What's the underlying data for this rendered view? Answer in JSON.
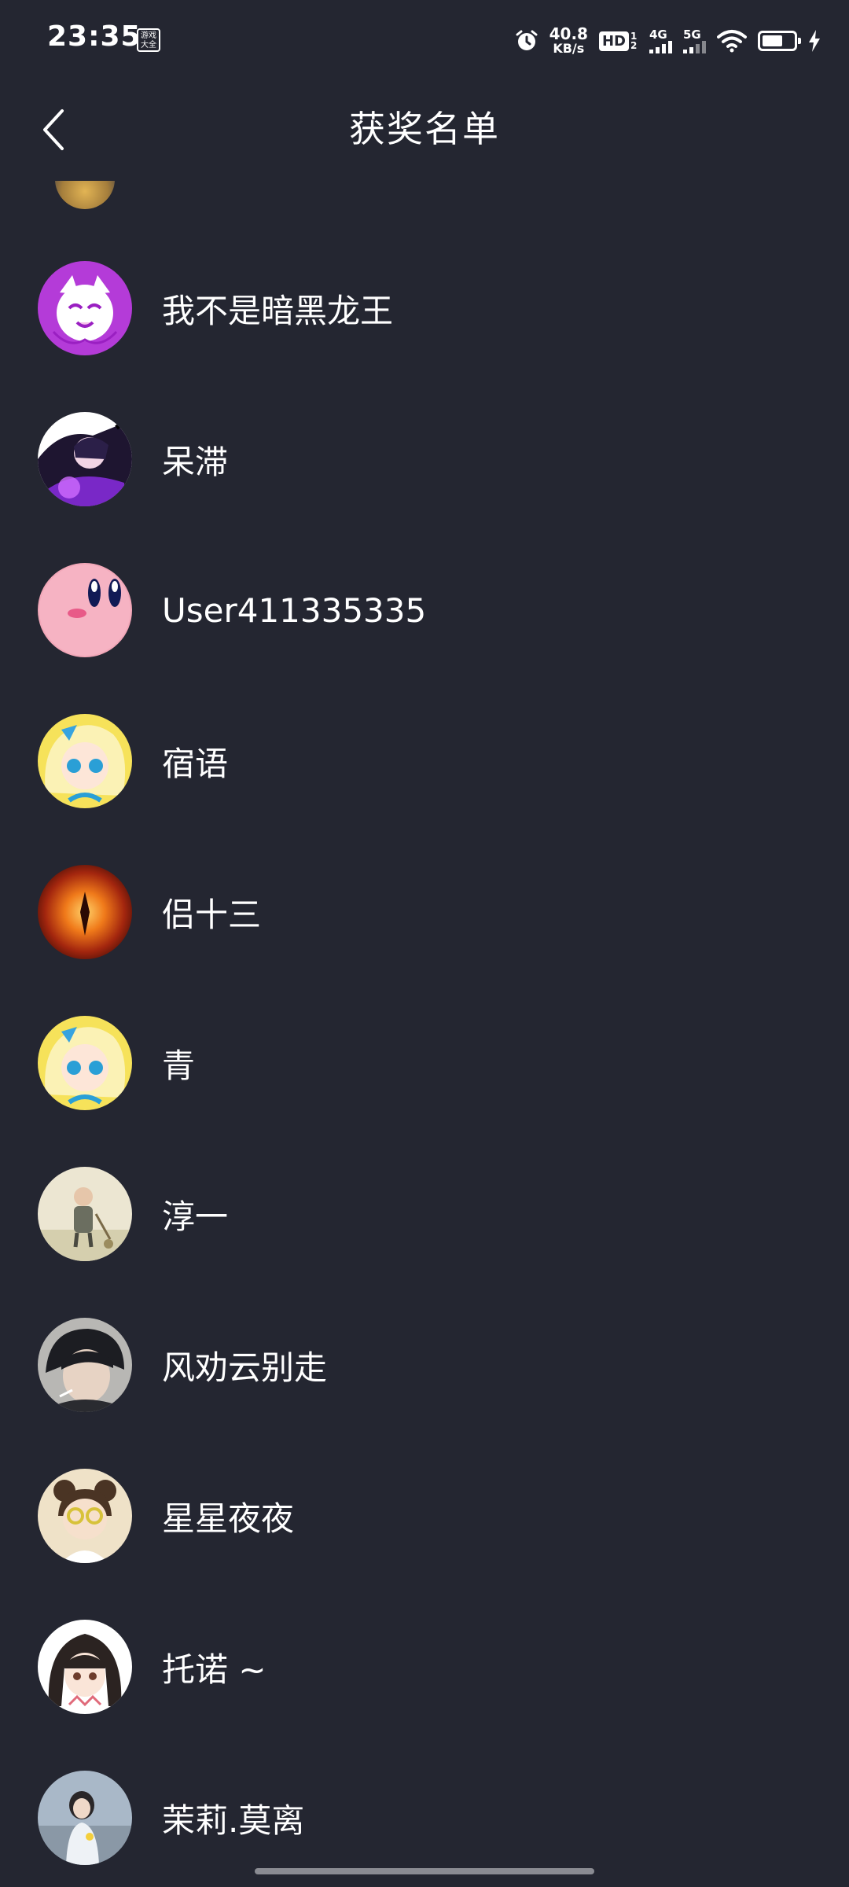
{
  "status_bar": {
    "time": "23:35",
    "game_badge": "游戏大全",
    "net_speed_value": "40.8",
    "net_speed_unit": "KB/s",
    "hd_label": "HD",
    "hd_sub": "1 2",
    "sim1_gen": "4G",
    "sim2_gen": "5G",
    "battery_level": 0.65
  },
  "header": {
    "title": "获奖名单",
    "back_icon": "chevron-left-icon"
  },
  "winners": [
    {
      "name": "我不是暗黑龙王",
      "avatar": "purple-anime-avatar"
    },
    {
      "name": "呆滞",
      "avatar": "dark-anime-girl-avatar"
    },
    {
      "name": "User411335335",
      "avatar": "pink-kirby-avatar"
    },
    {
      "name": "宿语",
      "avatar": "blonde-anime-girl-avatar"
    },
    {
      "name": "侣十三",
      "avatar": "fire-explosion-avatar"
    },
    {
      "name": "青",
      "avatar": "blonde-anime-girl-avatar"
    },
    {
      "name": "淳一",
      "avatar": "old-man-drawing-avatar"
    },
    {
      "name": "风劝云别走",
      "avatar": "dark-hair-boy-avatar"
    },
    {
      "name": "星星夜夜",
      "avatar": "girl-glasses-avatar"
    },
    {
      "name": "托诺 ~",
      "avatar": "anime-girl-hoodie-avatar"
    },
    {
      "name": "茉莉.莫离",
      "avatar": "girl-photo-avatar"
    }
  ],
  "colors": {
    "background": "#242631",
    "text": "#ffffff",
    "home_indicator": "#8a8b92"
  }
}
